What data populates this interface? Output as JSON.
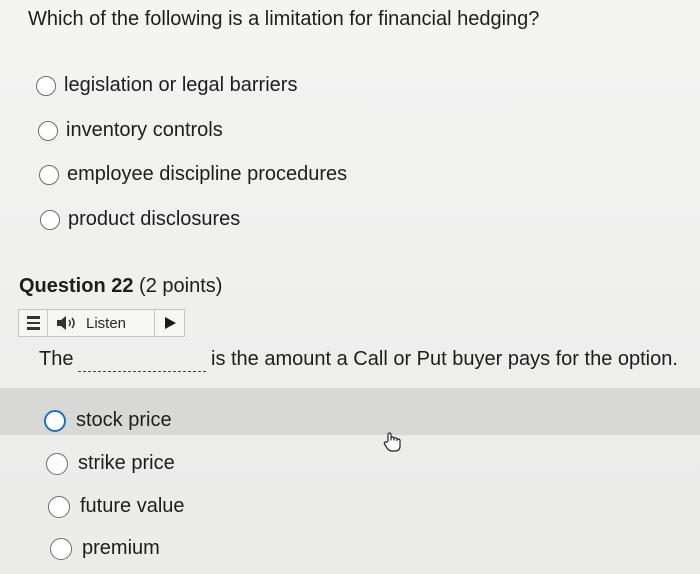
{
  "question1": {
    "text": "Which of the following is a limitation for financial hedging?",
    "options": [
      "legislation or legal barriers",
      "inventory controls",
      "employee discipline procedures",
      "product disclosures"
    ]
  },
  "question2": {
    "title_bold": "Question 22",
    "points": "(2 points)",
    "listen_label": "Listen",
    "sentence_start": "The",
    "sentence_end": "is the amount a Call or Put buyer pays for the option.",
    "options": [
      "stock price",
      "strike price",
      "future value",
      "premium"
    ]
  },
  "colors": {
    "focus_ring": "#1f6fc5",
    "highlight_row": "#d8d8d7"
  },
  "icons": {
    "menu": "menu-icon",
    "speaker": "speaker-icon",
    "play": "play-icon",
    "cursor": "hand-cursor-icon"
  }
}
